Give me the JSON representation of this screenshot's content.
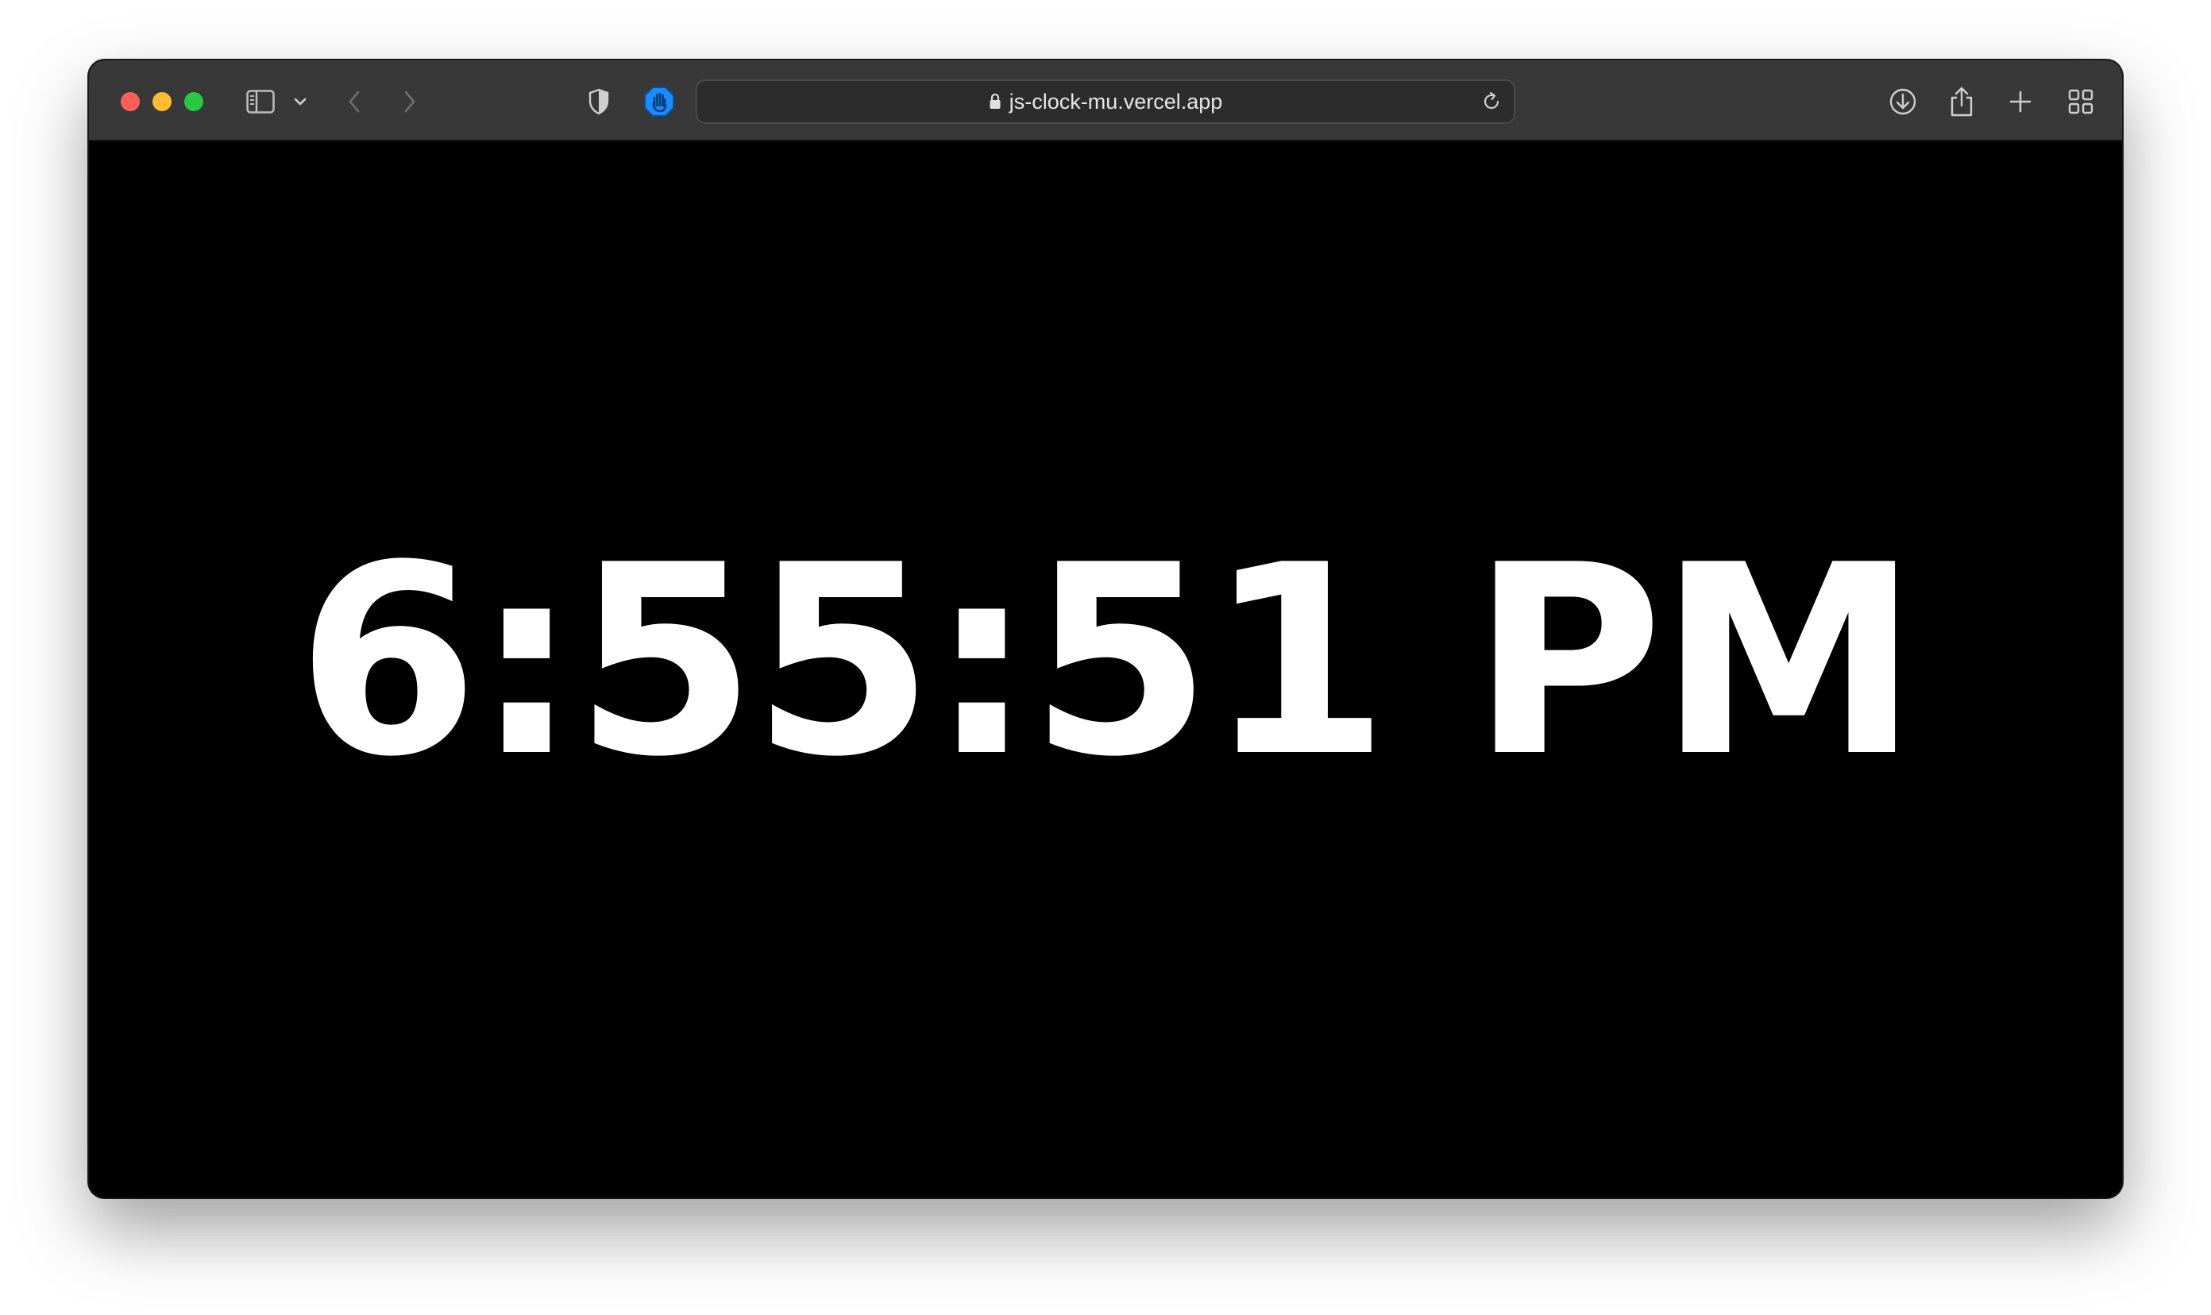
{
  "browser": {
    "url": "js-clock-mu.vercel.app",
    "icons": {
      "sidebar": "sidebar-icon",
      "sidebar_menu": "chevron-down-icon",
      "back": "chevron-left-icon",
      "forward": "chevron-right-icon",
      "privacy": "shield-icon",
      "extension": "hand-stop-icon",
      "lock": "lock-icon",
      "reload": "reload-icon",
      "downloads": "download-icon",
      "share": "share-icon",
      "new_tab": "plus-icon",
      "tab_overview": "grid-icon"
    },
    "colors": {
      "close": "#ff5f57",
      "minimize": "#febc2e",
      "maximize": "#28c840",
      "extension": "#1a8cff"
    }
  },
  "page": {
    "time": "6:55:51 PM",
    "background": "#000000",
    "text_color": "#ffffff"
  }
}
